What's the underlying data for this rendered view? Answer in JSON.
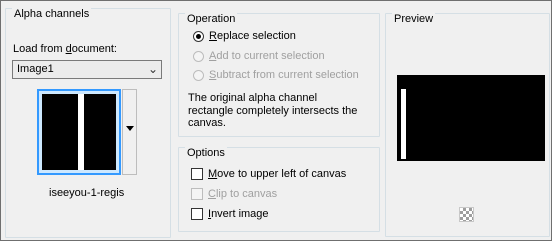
{
  "alpha_channels": {
    "title": "Alpha channels",
    "load_label_before": "Load from ",
    "load_label_underlined": "d",
    "load_label_after": "ocument:",
    "selected_document": "Image1",
    "channel_name": "iseeyou-1-regis"
  },
  "operation": {
    "title": "Operation",
    "options": [
      {
        "accel": "R",
        "rest": "eplace selection",
        "checked": true,
        "enabled": true
      },
      {
        "accel": "A",
        "rest": "dd to current selection",
        "checked": false,
        "enabled": false
      },
      {
        "accel": "S",
        "rest": "ubtract from current selection",
        "checked": false,
        "enabled": false
      }
    ],
    "message_line1": "The original alpha channel",
    "message_line2": "rectangle completely intersects the",
    "message_line3": "canvas."
  },
  "options": {
    "title": "Options",
    "items": [
      {
        "accel": "M",
        "rest": "ove to upper left of canvas",
        "checked": false,
        "enabled": true
      },
      {
        "accel": "C",
        "rest": "lip to canvas",
        "checked": false,
        "enabled": false
      },
      {
        "accel": "I",
        "rest": "nvert image",
        "checked": false,
        "enabled": true
      }
    ]
  },
  "preview": {
    "title": "Preview"
  },
  "colors": {
    "selection_blue": "#3399ff",
    "preview_background": "#000000",
    "dialog_background": "#f0f0f0"
  }
}
